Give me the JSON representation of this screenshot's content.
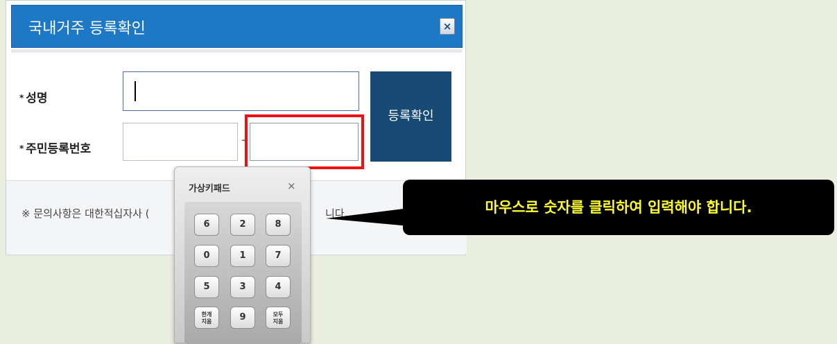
{
  "dialog": {
    "title": "국내거주 등록확인",
    "close_label": "×"
  },
  "form": {
    "name_label": "성명",
    "rrn_label": "주민등록번호",
    "required_mark": "*",
    "name_value": "",
    "rrn_front_value": "",
    "rrn_dash": "-",
    "rrn_back_value": "",
    "register_button_label": "등록확인"
  },
  "notice": {
    "text_visible": "※ 문의사항은 대한적십자사 (",
    "tail_visible": "니다."
  },
  "keypad": {
    "title": "가상키패드",
    "close_label": "×",
    "keys": [
      "6",
      "2",
      "8",
      "0",
      "1",
      "7",
      "5",
      "3",
      "4",
      "한개\n지움",
      "9",
      "모두\n지움"
    ]
  },
  "callout": {
    "text": "마우스로 숫자를 클릭하여 입력해야 합니다."
  },
  "colors": {
    "title_bar": "#1d78c6",
    "register_button": "#174a75",
    "highlight": "#ee1111",
    "callout_text": "#ffff2e",
    "background": "#eaeedf"
  }
}
